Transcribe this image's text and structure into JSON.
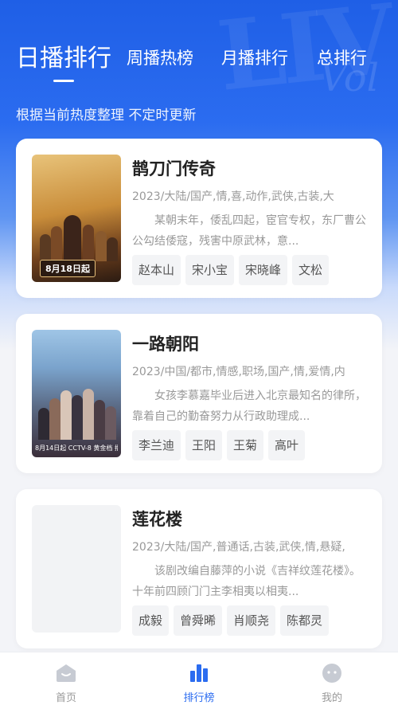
{
  "tabs": [
    {
      "label": "日播排行",
      "active": true
    },
    {
      "label": "周播热榜",
      "active": false
    },
    {
      "label": "月播排行",
      "active": false
    },
    {
      "label": "总排行",
      "active": false
    }
  ],
  "subtitle": "根据当前热度整理 不定时更新",
  "cards": [
    {
      "title": "鹊刀门传奇",
      "meta": "2023/大陆/国产,情,喜,动作,武侠,古装,大",
      "desc": "某朝末年，倭乱四起，宦官专权，东厂曹公公勾结倭寇，残害中原武林，意...",
      "poster_date": "8月18日起",
      "cast": [
        "赵本山",
        "宋小宝",
        "宋晓峰",
        "文松"
      ]
    },
    {
      "title": "一路朝阳",
      "meta": "2023/中国/都市,情感,职场,国产,情,爱情,内",
      "desc": "女孩李慕嘉毕业后进入北京最知名的律所，靠着自己的勤奋努力从行政助理成...",
      "poster_strip": "8月14日起 CCTV-8 黄金档 播出",
      "cast": [
        "李兰迪",
        "王阳",
        "王菊",
        "高叶"
      ]
    },
    {
      "title": "莲花楼",
      "meta": "2023/大陆/国产,普通话,古装,武侠,情,悬疑,",
      "desc": "该剧改编自藤萍的小说《吉祥纹莲花楼》。十年前四顾门门主李相夷以相夷...",
      "cast": [
        "成毅",
        "曾舜晞",
        "肖顺尧",
        "陈都灵"
      ]
    }
  ],
  "nav": [
    {
      "label": "首页",
      "icon": "home-icon",
      "active": false
    },
    {
      "label": "排行榜",
      "icon": "chart-icon",
      "active": true
    },
    {
      "label": "我的",
      "icon": "profile-icon",
      "active": false
    }
  ],
  "colors": {
    "accent": "#2b6cf0",
    "hero": "#1f5fe6"
  }
}
